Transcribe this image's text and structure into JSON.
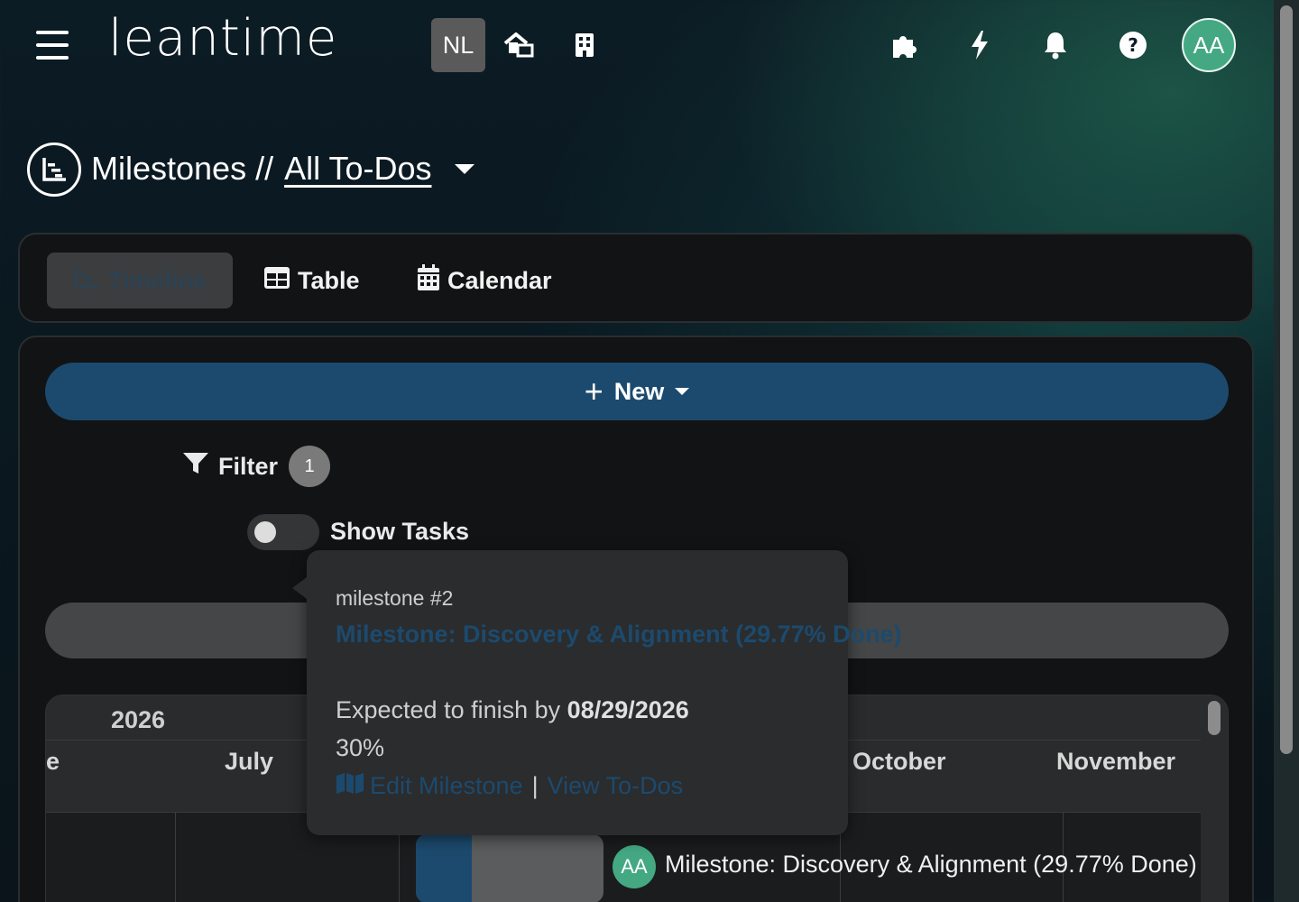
{
  "header": {
    "logo_text": "leantime",
    "project_badge": "NL",
    "avatar_initials": "AA",
    "icons": [
      "home-switch-icon",
      "building-icon",
      "puzzle-icon",
      "bolt-icon",
      "bell-icon",
      "help-icon"
    ]
  },
  "page": {
    "title": "Milestones",
    "separator": "//",
    "view_name": "All To-Dos"
  },
  "tabs": [
    {
      "label": "Timeline",
      "active": true
    },
    {
      "label": "Table",
      "active": false
    },
    {
      "label": "Calendar",
      "active": false
    }
  ],
  "toolbar": {
    "new_label": "New",
    "filter_label": "Filter",
    "filter_count": "1",
    "show_tasks_label": "Show Tasks",
    "show_tasks_on": false
  },
  "gantt": {
    "year": "2026",
    "months": [
      "e",
      "July",
      "October",
      "November"
    ],
    "row": {
      "avatar": "AA",
      "label": "Milestone: Discovery & Alignment (29.77% Done)",
      "progress": 0.3
    }
  },
  "tooltip": {
    "heading": "milestone #2",
    "title_link": "Milestone: Discovery & Alignment (29.77% Done)",
    "expected_prefix": "Expected to finish by",
    "expected_date": "08/29/2026",
    "percent": "30%",
    "edit_label": "Edit Milestone",
    "pipe": "|",
    "view_label": "View To-Dos"
  },
  "colors": {
    "accent": "#1c4a6e",
    "avatar": "#44a883",
    "card_bg": "#111314"
  }
}
